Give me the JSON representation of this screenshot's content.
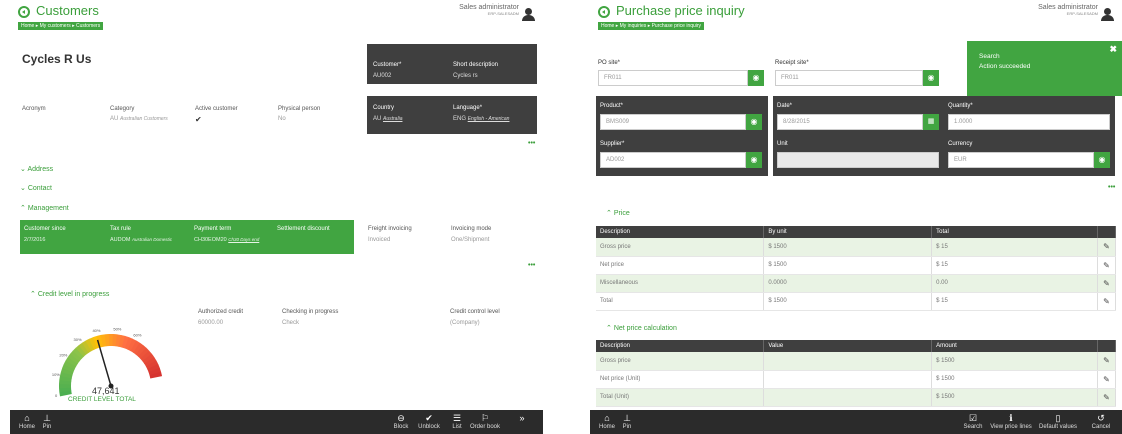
{
  "left": {
    "title": "Customers",
    "breadcrumb": "Home ▸ My customers ▸ Customers",
    "user": {
      "name": "Sales administrator",
      "site": "ERP-SALESADM"
    },
    "customer_name": "Cycles R Us",
    "header_panel": {
      "customer_label": "Customer*",
      "customer_value": "AU002",
      "short_desc_label": "Short description",
      "short_desc_value": "Cycles rs",
      "country_label": "Country",
      "country_value": "AU",
      "country_name": "Australia",
      "language_label": "Language*",
      "language_value": "ENG",
      "language_name": "English - American"
    },
    "info": {
      "acronym_label": "Acronym",
      "category_label": "Category",
      "category_value": "AU",
      "category_name": "Australian Customers",
      "active_label": "Active customer",
      "active_value": "✔",
      "physical_label": "Physical person",
      "physical_value": "No"
    },
    "sections": {
      "address": "Address",
      "contact": "Contact",
      "management": "Management",
      "credit": "Credit level in progress"
    },
    "management": {
      "since_label": "Customer since",
      "since_value": "2/7/2016",
      "tax_label": "Tax rule",
      "tax_value": "AUDOM",
      "tax_name": "Australian Domestic",
      "payment_label": "Payment term",
      "payment_value": "CH30EOM20",
      "payment_name": "Ch30 Days end",
      "settlement_label": "Settlement discount",
      "freight_label": "Freight invoicing",
      "freight_value": "Invoiced",
      "invoicing_label": "Invoicing mode",
      "invoicing_value": "One/Shipment"
    },
    "credit": {
      "authorized_label": "Authorized credit",
      "authorized_value": "60000.00",
      "checking_label": "Checking in progress",
      "checking_value": "Check",
      "control_label": "Credit control level",
      "control_value": "(Company)",
      "gauge_value": "47,641",
      "gauge_caption": "CREDIT LEVEL TOTAL",
      "gauge_percent": 42,
      "gauge_ticks": [
        "0",
        "10%",
        "20%",
        "30%",
        "40%",
        "50%",
        "60%"
      ]
    },
    "bottom": {
      "home": "Home",
      "pin": "Pin",
      "block": "Block",
      "unblock": "Unblock",
      "list": "List",
      "order_book": "Order book"
    }
  },
  "right": {
    "title": "Purchase price inquiry",
    "breadcrumb": "Home ▸ My inquiries ▸ Purchase price inquiry",
    "user": {
      "name": "Sales administrator",
      "site": "ERP-SALESADM"
    },
    "toast": {
      "title": "Search",
      "message": "Action succeeded"
    },
    "po_site_label": "PO site*",
    "po_site_value": "FR011",
    "receipt_site_label": "Receipt site*",
    "receipt_site_value": "FR011",
    "product_label": "Product*",
    "product_value": "BMS009",
    "date_label": "Date*",
    "date_value": "8/28/2015",
    "quantity_label": "Quantity*",
    "quantity_value": "1.0000",
    "supplier_label": "Supplier*",
    "supplier_value": "AD002",
    "unit_label": "Unit",
    "unit_value": "",
    "currency_label": "Currency",
    "currency_value": "EUR",
    "price_section": "Price",
    "price_table": {
      "headers": [
        "Description",
        "By unit",
        "Total"
      ],
      "rows": [
        [
          "Gross price",
          "$ 1500",
          "$ 15"
        ],
        [
          "Net price",
          "$ 1500",
          "$ 15"
        ],
        [
          "Miscellaneous",
          "0.0000",
          "0.00"
        ],
        [
          "Total",
          "$ 1500",
          "$ 15"
        ]
      ]
    },
    "net_section": "Net price calculation",
    "net_table": {
      "headers": [
        "Description",
        "Value",
        "Amount"
      ],
      "rows": [
        [
          "Gross price",
          "",
          "$ 1500"
        ],
        [
          "Net price (Unit)",
          "",
          "$ 1500"
        ],
        [
          "Total (Unit)",
          "",
          "$ 1500"
        ]
      ]
    },
    "bottom": {
      "home": "Home",
      "pin": "Pin",
      "search": "Search",
      "view_lines": "View price lines",
      "defaults": "Default values",
      "cancel": "Cancel"
    }
  },
  "colors": {
    "accent": "#41a541",
    "dark": "#3f3f3f",
    "bar": "#2b2b2b"
  }
}
